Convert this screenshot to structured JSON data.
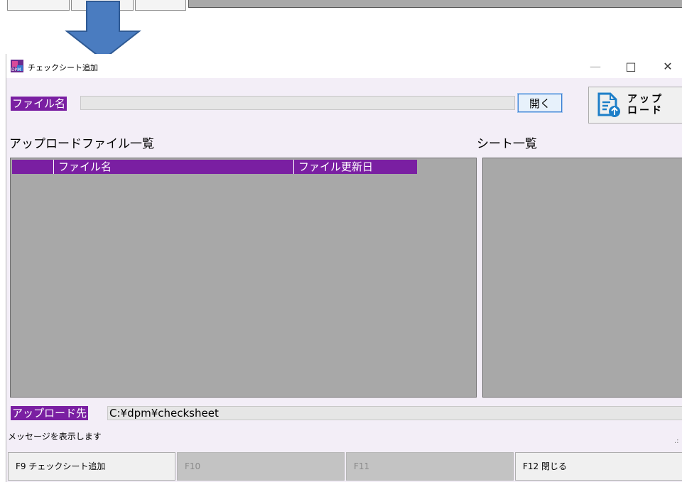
{
  "window": {
    "title": "チェックシート追加",
    "controls": {
      "minimize": "—",
      "maximize": "□",
      "close": "✕"
    }
  },
  "file_section": {
    "label": "ファイル名",
    "value": "",
    "open_button": "開く"
  },
  "upload_button": {
    "line1": "アップ",
    "line2": "ロード",
    "icon": "document-upload-icon"
  },
  "upload_list": {
    "title": "アップロードファイル一覧",
    "columns": [
      "",
      "ファイル名",
      "ファイル更新日"
    ],
    "rows": []
  },
  "sheet_list": {
    "title": "シート一覧",
    "rows": []
  },
  "destination": {
    "label": "アップロード先",
    "value": "C:¥dpm¥checksheet"
  },
  "status": {
    "message": "メッセージを表示します"
  },
  "function_keys": [
    {
      "label": "F9 チェックシート追加",
      "enabled": true
    },
    {
      "label": "F10",
      "enabled": false
    },
    {
      "label": "F11",
      "enabled": false
    },
    {
      "label": "F12 閉じる",
      "enabled": true
    }
  ],
  "colors": {
    "accent_purple": "#7a1fa2",
    "list_background": "#a8a8a8",
    "window_background": "#f3eef7",
    "arrow_blue": "#4a7cc0"
  }
}
